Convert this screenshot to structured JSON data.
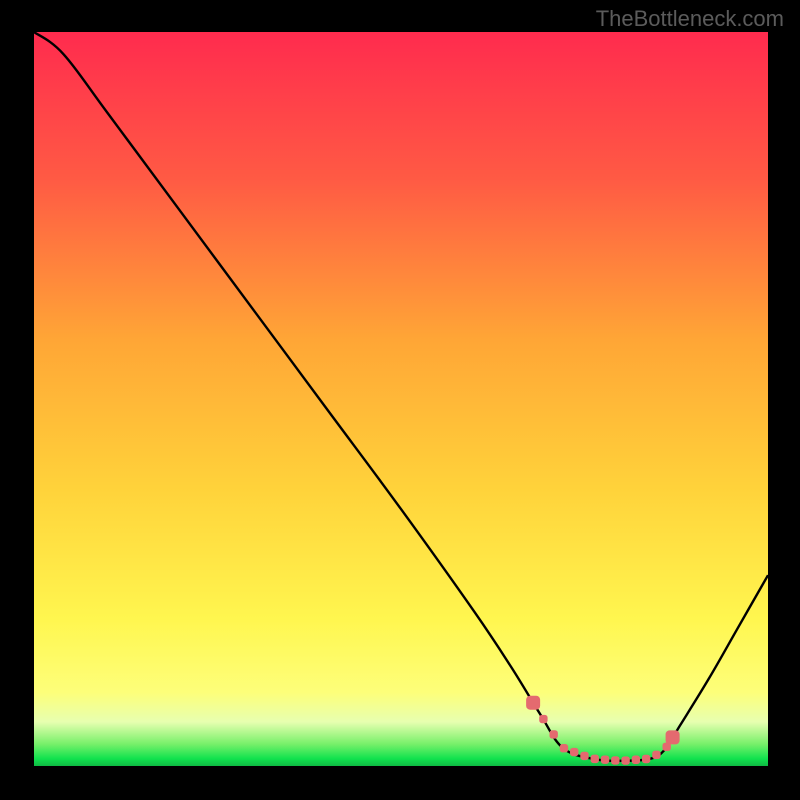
{
  "watermark": "TheBottleneck.com",
  "chart_data": {
    "type": "line",
    "title": "",
    "xlabel": "",
    "ylabel": "",
    "xlim": [
      0,
      100
    ],
    "ylim": [
      0,
      100
    ],
    "background_gradient": {
      "top": "#ff2b4e",
      "mid_upper": "#ff7a3e",
      "mid": "#ffd23a",
      "mid_lower": "#fffb60",
      "green_band": "#11e24e",
      "bottom_border": "#000000"
    },
    "curve": {
      "description": "V-shaped bottleneck curve descending from top-left to a minimum plateau near x≈72-85 then rising toward right edge",
      "x": [
        0,
        4,
        10,
        20,
        30,
        40,
        50,
        60,
        65,
        69,
        72,
        76,
        80,
        84,
        86,
        88,
        92,
        96,
        100
      ],
      "y": [
        100,
        97,
        89,
        75.5,
        62,
        48.5,
        35,
        21,
        13.5,
        7,
        2.5,
        1,
        0.7,
        1,
        2.3,
        5.5,
        12,
        19,
        26
      ]
    },
    "optimal_band": {
      "description": "Pink marker band indicating optimal region along the curve trough",
      "x_start": 68,
      "x_end": 87,
      "color": "#e46a6f"
    }
  }
}
